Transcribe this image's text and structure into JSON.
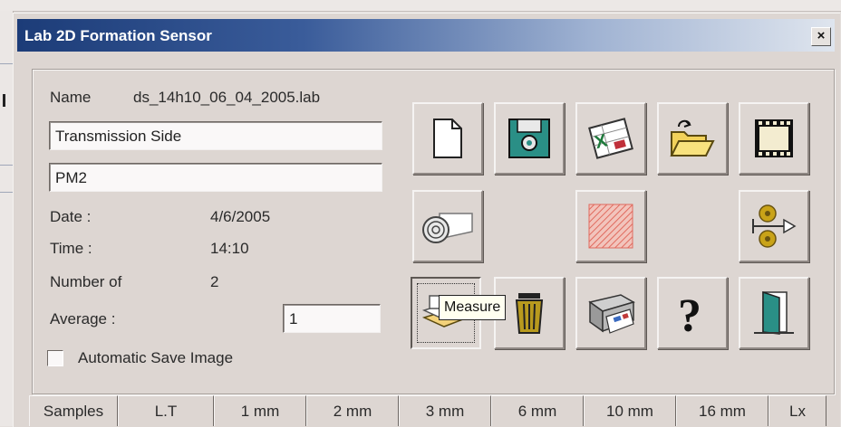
{
  "window": {
    "title": "Lab 2D Formation Sensor",
    "close_label": "×"
  },
  "form": {
    "name_label": "Name",
    "name_value": "ds_14h10_06_04_2005.lab",
    "field1_value": "Transmission Side",
    "field2_value": "PM2",
    "date_label": "Date :",
    "date_value": "4/6/2005",
    "time_label": "Time :",
    "time_value": "14:10",
    "number_label": "Number of",
    "number_value": "2",
    "average_label": "Average :",
    "average_value": "1",
    "autosave_label": "Automatic Save Image",
    "autosave_checked": false
  },
  "toolbar": {
    "buttons": [
      {
        "icon": "new-document-icon"
      },
      {
        "icon": "save-disk-icon"
      },
      {
        "icon": "excel-export-icon"
      },
      {
        "icon": "open-folder-icon"
      },
      {
        "icon": "film-icon"
      },
      {
        "icon": "paper-roll-icon"
      },
      {
        "icon": "formation-pattern-icon"
      },
      {
        "icon": "roll-feed-icon"
      },
      {
        "icon": "measure-icon",
        "pressed": true
      },
      {
        "icon": "trash-icon"
      },
      {
        "icon": "printer-icon"
      },
      {
        "icon": "help-icon"
      },
      {
        "icon": "exit-door-icon"
      }
    ],
    "tooltip": "Measure"
  },
  "table": {
    "headers": [
      "Samples",
      "L.T",
      "1 mm",
      "2 mm",
      "3 mm",
      "6 mm",
      "10 mm",
      "16 mm",
      "Lx"
    ]
  },
  "colors": {
    "title_gradient_start": "#1c3c78",
    "title_gradient_end": "#dfe5ee",
    "dialog_bg": "#ddd6d2"
  }
}
